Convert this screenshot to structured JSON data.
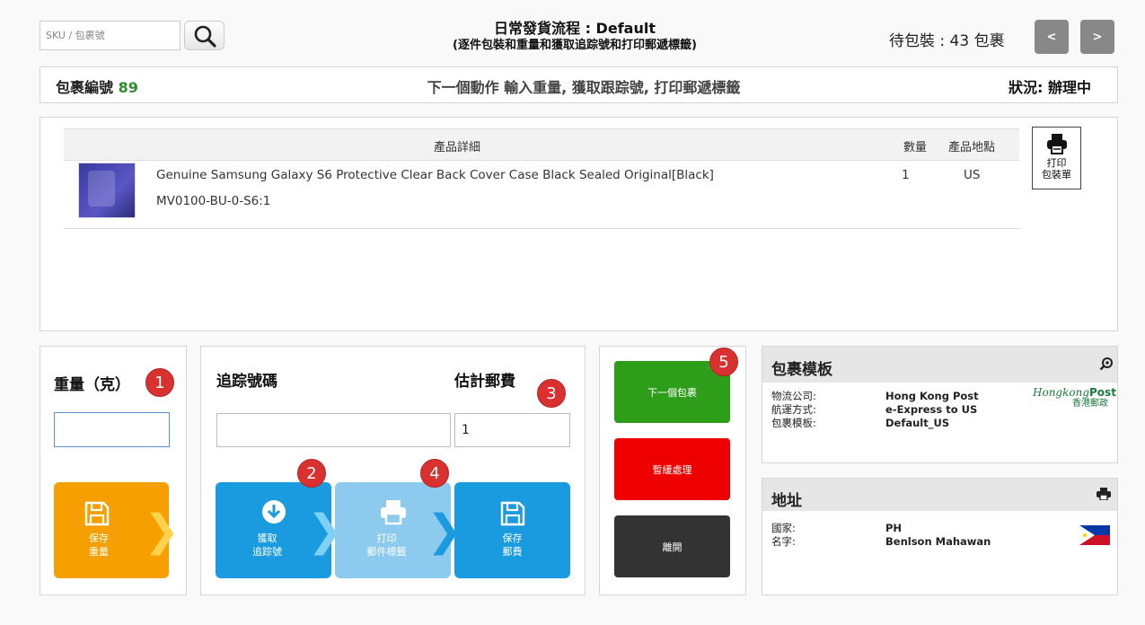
{
  "top": {
    "search_placeholder": "SKU / 包裹號",
    "title_line1": "日常發貨流程 : Default",
    "title_line2": "(逐件包裝和重量和獲取追踪號和打印郵遞標籤)",
    "pending_label": "待包裝 : 43 包裹",
    "prev_label": "<",
    "next_label": ">"
  },
  "status_bar": {
    "package_label": "包裹編號",
    "package_number": "89",
    "next_action": "下一個動作 輸入重量, 獲取跟踪號, 打印郵遞標籤",
    "status": "狀況: 辦理中"
  },
  "products": {
    "headers": {
      "detail": "產品詳細",
      "qty": "數量",
      "location": "產品地點"
    },
    "rows": [
      {
        "name": "Genuine Samsung Galaxy S6 Protective Clear Back Cover Case Black Sealed Original[Black]",
        "sku": "MV0100-BU-0-S6:1",
        "qty": "1",
        "location": "US"
      }
    ],
    "print_label_1": "打印",
    "print_label_2": "包裝單"
  },
  "weight": {
    "label": "重量（克）",
    "badge": "1",
    "value": "",
    "save_line1": "保存",
    "save_line2": "重量"
  },
  "tracking": {
    "label": "追踪號碼",
    "fee_label": "估計郵費",
    "badge_fee": "3",
    "tracking_value": "",
    "fee_value": "1",
    "get_badge": "2",
    "get_line1": "獲取",
    "get_line2": "追踪號",
    "print_badge": "4",
    "print_line1": "打印",
    "print_line2": "郵件標籤",
    "save_line1": "保存",
    "save_line2": "郵費"
  },
  "actions": {
    "badge": "5",
    "next_package": "下一個包裹",
    "hold": "暫緩處理",
    "leave": "離開",
    "colors": {
      "next": "#2e9e1a",
      "hold": "#ee0000",
      "leave": "#333333"
    }
  },
  "template": {
    "title": "包裹模板",
    "courier_label": "物流公司:",
    "courier_value": "Hong Kong Post",
    "method_label": "航運方式:",
    "method_value": "e-Express to US",
    "tpl_label": "包裹模板:",
    "tpl_value": "Default_US",
    "logo_en_1": "Hongkong",
    "logo_en_2": "Post",
    "logo_zh": "香港郵政"
  },
  "address": {
    "title": "地址",
    "country_label": "國家:",
    "country_value": "PH",
    "name_label": "名字:",
    "name_value": "Benlson Mahawan"
  }
}
